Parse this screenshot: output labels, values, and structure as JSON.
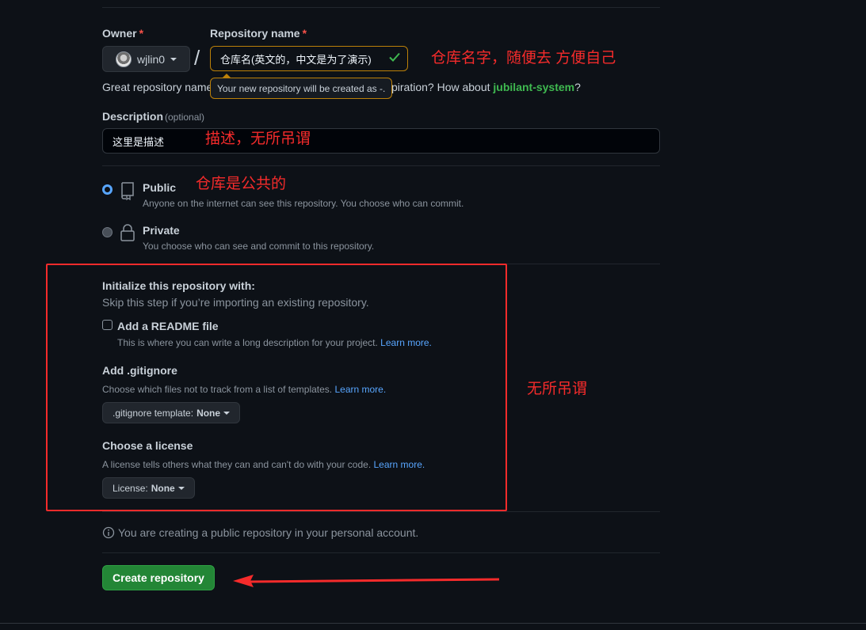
{
  "owner": {
    "label": "Owner",
    "required_mark": "*",
    "value": "wjlin0"
  },
  "repo_name": {
    "label": "Repository name",
    "required_mark": "*",
    "value": "仓库名(英文的，中文是为了演示)",
    "separator": "/",
    "tooltip": "Your new repository will be created as -."
  },
  "hint": {
    "prefix": "Great repository name",
    "suffix_prefix": "piration? How about ",
    "suggestion": "jubilant-system",
    "suffix": "?"
  },
  "description": {
    "label": "Description",
    "optional": "(optional)",
    "value": "这里是描述"
  },
  "visibility": {
    "public": {
      "title": "Public",
      "desc": "Anyone on the internet can see this repository. You choose who can commit.",
      "checked": true
    },
    "private": {
      "title": "Private",
      "desc": "You choose who can see and commit to this repository.",
      "checked": false
    }
  },
  "initialize": {
    "title": "Initialize this repository with:",
    "subtitle": "Skip this step if you’re importing an existing repository.",
    "readme": {
      "label": "Add a README file",
      "desc": "This is where you can write a long description for your project.",
      "link": "Learn more."
    },
    "gitignore": {
      "title": "Add .gitignore",
      "desc": "Choose which files not to track from a list of templates.",
      "link": "Learn more.",
      "button_prefix": ".gitignore template:",
      "button_value": "None"
    },
    "license": {
      "title": "Choose a license",
      "desc": "A license tells others what they can and can't do with your code.",
      "link": "Learn more.",
      "button_prefix": "License:",
      "button_value": "None"
    }
  },
  "info_note": "You are creating a public repository in your personal account.",
  "create_button": "Create repository",
  "annotations": {
    "repo_name": "仓库名字，随便去 方便自己",
    "description": "描述，无所吊谓",
    "public": "仓库是公共的",
    "init": "无所吊谓"
  },
  "colors": {
    "background": "#0d1117",
    "accent_green": "#238636",
    "link_blue": "#58a6ff",
    "annotation_red": "#f52b2b",
    "warning_border": "#bb8009"
  }
}
